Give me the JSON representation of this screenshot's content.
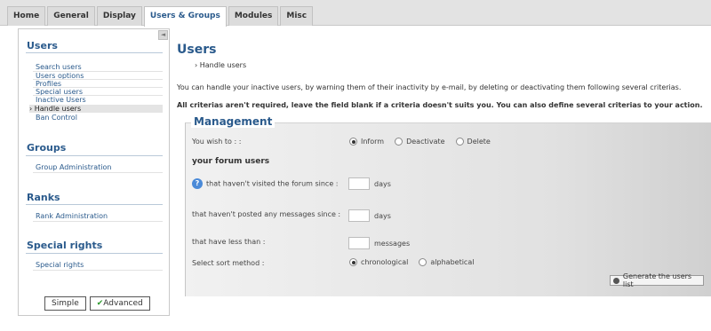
{
  "tabs": [
    {
      "label": "Home"
    },
    {
      "label": "General"
    },
    {
      "label": "Display"
    },
    {
      "label": "Users & Groups"
    },
    {
      "label": "Modules"
    },
    {
      "label": "Misc"
    }
  ],
  "active_tab": "Users & Groups",
  "sidebar": {
    "collapse_glyph": "◄",
    "sections": [
      {
        "title": "Users",
        "items": [
          "Search users",
          "Users options",
          "Profiles",
          "Special users",
          "Inactive Users",
          "Handle users",
          "Ban Control"
        ]
      },
      {
        "title": "Groups",
        "items": [
          "Group Administration"
        ]
      },
      {
        "title": "Ranks",
        "items": [
          "Rank Administration"
        ]
      },
      {
        "title": "Special rights",
        "items": [
          "Special rights"
        ]
      }
    ],
    "active_item": "Handle users",
    "simple_label": "Simple",
    "advanced_label": "Advanced"
  },
  "main": {
    "title": "Users",
    "breadcrumb": "Handle users",
    "intro": "You can handle your inactive users, by warning them of their inactivity by e-mail, by deleting or deactivating them following several criterias.",
    "note": "All criterias aren't required, leave the field blank if a criteria doesn't suits you. You can also define several criterias to your action.",
    "panel_title": "Management",
    "wish_label": "You wish to : :",
    "action_options": [
      "Inform",
      "Deactivate",
      "Delete"
    ],
    "action_selected": "Inform",
    "forum_users_heading": "your forum users",
    "criteria": [
      {
        "label": "that haven't visited the forum since :",
        "value": "",
        "unit": "days"
      },
      {
        "label": "that haven't posted any messages since :",
        "value": "",
        "unit": "days"
      },
      {
        "label": "that have less than :",
        "value": "",
        "unit": "messages"
      }
    ],
    "help_glyph": "?",
    "sort_label": "Select sort method :",
    "sort_options": [
      "chronological",
      "alphabetical"
    ],
    "sort_selected": "chronological",
    "generate_button": "Generate the users list"
  },
  "colors": {
    "accent": "#2a5a8c",
    "help_icon": "#4a8ad8",
    "check": "#2e9a2e"
  }
}
